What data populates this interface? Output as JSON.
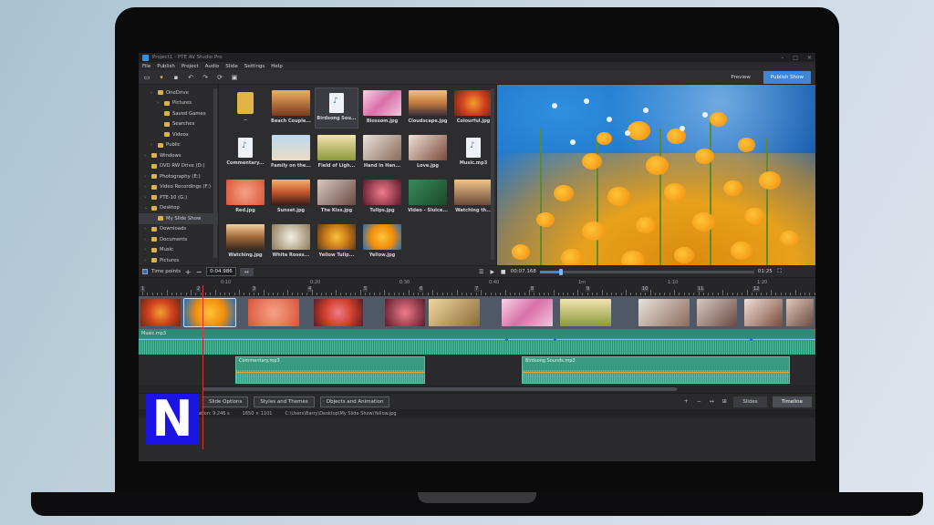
{
  "app": {
    "title": "Project1 - PTE AV Studio Pro",
    "window_controls": [
      "–",
      "□",
      "✕"
    ]
  },
  "menu": [
    "File",
    "Publish",
    "Project",
    "Audio",
    "Slide",
    "Settings",
    "Help"
  ],
  "toolbar": {
    "icons": [
      "new-icon",
      "open-icon",
      "save-icon",
      "undo-icon",
      "redo-icon",
      "refresh-icon",
      "display-icon"
    ],
    "preview_label": "Preview",
    "publish_label": "Publish Show"
  },
  "tree": [
    {
      "label": "OneDrive",
      "level": 1,
      "arrow": "›"
    },
    {
      "label": "Pictures",
      "level": 2,
      "arrow": "›"
    },
    {
      "label": "Saved Games",
      "level": 2,
      "arrow": ""
    },
    {
      "label": "Searches",
      "level": 2,
      "arrow": ""
    },
    {
      "label": "Videos",
      "level": 2,
      "arrow": ""
    },
    {
      "label": "Public",
      "level": 1,
      "arrow": "›"
    },
    {
      "label": "Windows",
      "level": 0,
      "arrow": "›"
    },
    {
      "label": "DVD RW Drive (D:)",
      "level": 0,
      "arrow": ""
    },
    {
      "label": "Photography (E:)",
      "level": 0,
      "arrow": "›"
    },
    {
      "label": "Video Recordings (F:)",
      "level": 0,
      "arrow": "›"
    },
    {
      "label": "PTE-10 (G:)",
      "level": 0,
      "arrow": "›"
    },
    {
      "label": "Desktop",
      "level": 0,
      "arrow": "⌄"
    },
    {
      "label": "My Slide Show",
      "level": 1,
      "arrow": "",
      "selected": true
    },
    {
      "label": "Downloads",
      "level": 0,
      "arrow": "›"
    },
    {
      "label": "Documents",
      "level": 0,
      "arrow": "›"
    },
    {
      "label": "Music",
      "level": 0,
      "arrow": "›"
    },
    {
      "label": "Pictures",
      "level": 0,
      "arrow": "›"
    }
  ],
  "files": [
    {
      "label": "..",
      "kind": "folder"
    },
    {
      "label": "Beach Couple...",
      "kind": "photo",
      "color": "linear-gradient(180deg,#f0b060,#7a3b20)"
    },
    {
      "label": "Birdsong Sou...",
      "kind": "audio",
      "selected": true
    },
    {
      "label": "Blossom.jpg",
      "kind": "photo",
      "color": "linear-gradient(135deg,#f7d3e6,#d96fa8,#f0c6dd)"
    },
    {
      "label": "Cloudscape.jpg",
      "kind": "photo",
      "color": "linear-gradient(180deg,#f2c37a,#c37a3e,#3b2f3a)"
    },
    {
      "label": "Colourful.jpg",
      "kind": "photo",
      "color": "radial-gradient(circle,#f0a030,#d04020,#6a2a18)"
    },
    {
      "label": "Commentary...",
      "kind": "audio"
    },
    {
      "label": "Family on the...",
      "kind": "photo",
      "color": "linear-gradient(180deg,#bcd8ee,#e9dcc4)"
    },
    {
      "label": "Field of Ligh...",
      "kind": "photo",
      "color": "linear-gradient(180deg,#f3e3b0,#8a9a3a)"
    },
    {
      "label": "Hand in Han...",
      "kind": "photo",
      "color": "linear-gradient(135deg,#e8e2dc,#8b6b5a)"
    },
    {
      "label": "Love.jpg",
      "kind": "photo",
      "color": "linear-gradient(135deg,#f0e0d8,#7a4b3a)"
    },
    {
      "label": "Music.mp3",
      "kind": "audio"
    },
    {
      "label": "Red.jpg",
      "kind": "photo",
      "color": "radial-gradient(circle,#f6a286,#d9553a)"
    },
    {
      "label": "Sunset.jpg",
      "kind": "photo",
      "color": "linear-gradient(180deg,#f4b36a,#c2552c,#3a1c1a)"
    },
    {
      "label": "The Kiss.jpg",
      "kind": "photo",
      "color": "linear-gradient(135deg,#d8c8c0,#6a4a42)"
    },
    {
      "label": "Tulips.jpg",
      "kind": "photo",
      "color": "radial-gradient(circle,#f07a8a,#5a1a2a)"
    },
    {
      "label": "Video - Sluice...",
      "kind": "photo",
      "color": "linear-gradient(135deg,#3a8a5a,#1a4a2a)"
    },
    {
      "label": "Watching th...",
      "kind": "photo",
      "color": "linear-gradient(180deg,#f2c58a,#6a4a3a)"
    },
    {
      "label": "Watching.jpg",
      "kind": "photo",
      "color": "linear-gradient(180deg,#f5d0a0,#a26a3a,#3a2a20)"
    },
    {
      "label": "White Roses...",
      "kind": "photo",
      "color": "radial-gradient(circle,#f5efe2,#8a7a5a)"
    },
    {
      "label": "Yellow Tulip...",
      "kind": "photo",
      "color": "radial-gradient(circle,#f6c23a,#c87a1a,#5a3a1a)"
    },
    {
      "label": "Yellow.jpg",
      "kind": "photo",
      "color": "radial-gradient(circle,#ffc43a,#f08c0c,#1a6fc6)"
    }
  ],
  "timeline": {
    "time_points_label": "Time points",
    "time_value": "0:04.986",
    "playback_time": "00:07.168",
    "duration": "01:25",
    "playback_progress": 0.09,
    "ruler_times": [
      "0:10",
      "0:20",
      "0:30",
      "0:40",
      "1m",
      "1:10",
      "1:20"
    ],
    "ruler_numbers": [
      "1",
      "2",
      "3",
      "4",
      "5",
      "6",
      "7",
      "8",
      "9",
      "10",
      "11",
      "12"
    ],
    "slides": [
      {
        "color": "radial-gradient(circle,#f0a030,#d04020,#6a2a18)"
      },
      {
        "color": "radial-gradient(circle,#ffc43a,#f08c0c,#1a6fc6)",
        "selected": true
      },
      {
        "color": "radial-gradient(circle,#f6a286,#d9553a)"
      },
      {
        "color": "radial-gradient(circle,#f07a8a,#d0402a,#5a1a2a)"
      },
      {
        "color": "radial-gradient(circle,#f07a8a,#5a1a2a)"
      },
      {
        "color": "linear-gradient(135deg,#f0d8a0,#8a6a3a)"
      },
      {
        "color": "linear-gradient(135deg,#f7d3e6,#d96fa8,#f0c6dd)"
      },
      {
        "color": "linear-gradient(180deg,#f3e3b0,#8a9a3a)"
      },
      {
        "color": "linear-gradient(135deg,#e8e2dc,#8b6b5a)"
      },
      {
        "color": "linear-gradient(135deg,#d8c8c0,#6a4a42)"
      },
      {
        "color": "linear-gradient(135deg,#f0e0d8,#7a4b3a)"
      },
      {
        "color": "linear-gradient(135deg,#e0c8b8,#6a4a42)"
      }
    ],
    "music_label": "Music.mp3",
    "commentary_label": "Commentary.mp3",
    "birdsong_label": "Birdsong Sounds.mp3"
  },
  "bottom": {
    "slide_options": "Slide Options",
    "styles_themes": "Styles and Themes",
    "objects_animation": "Objects and Animation",
    "slides_tab": "Slides",
    "timeline_tab": "Timeline"
  },
  "status": {
    "duration": "uration: 9.246 s",
    "resolution": "1650 × 1101",
    "path": "C:\\Users\\Barry\\Desktop\\My Slide Show\\Yellow.jpg"
  },
  "logo": {
    "letter": "N",
    "color": "#1c14e6"
  }
}
